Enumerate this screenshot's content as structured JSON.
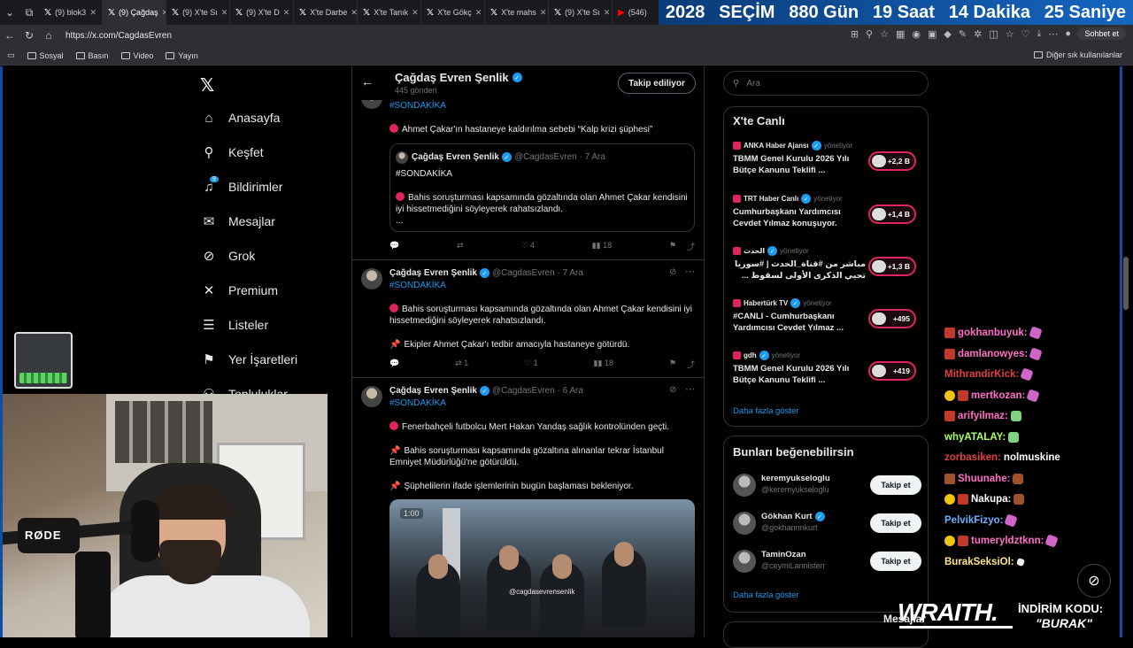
{
  "browser": {
    "tabs": [
      {
        "label": "(9) blok3",
        "icon": "x-icon",
        "active": false
      },
      {
        "label": "(9) Çağdaş",
        "icon": "x-icon",
        "active": true
      },
      {
        "label": "(9) X'te Sı",
        "icon": "x-icon",
        "active": false
      },
      {
        "label": "(9) X'te D",
        "icon": "x-icon",
        "active": false
      },
      {
        "label": "X'te Darbe",
        "icon": "x-icon",
        "active": false
      },
      {
        "label": "X'te Tanık",
        "icon": "x-icon",
        "active": false
      },
      {
        "label": "X'te Gökç",
        "icon": "x-icon",
        "active": false
      },
      {
        "label": "X'te mahs",
        "icon": "x-icon",
        "active": false
      },
      {
        "label": "(9) X'te Sı",
        "icon": "x-icon",
        "active": false
      },
      {
        "label": "(546)",
        "icon": "youtube-icon",
        "active": false
      }
    ],
    "banner": [
      "2028",
      "SEÇİM",
      "880 Gün",
      "19 Saat",
      "14 Dakika",
      "25 Saniye"
    ],
    "url": "https://x.com/CagdasEvren",
    "chat_button": "Sohbet et",
    "bookmarks": [
      "Sosyal",
      "Basın",
      "Video",
      "Yayın"
    ],
    "bookmarks_other": "Diğer sık kullanılanlar"
  },
  "nav": {
    "items": [
      {
        "label": "Anasayfa",
        "icon": "home-icon",
        "glyph": "⌂"
      },
      {
        "label": "Keşfet",
        "icon": "search-icon",
        "glyph": "⚲"
      },
      {
        "label": "Bildirimler",
        "icon": "bell-icon",
        "glyph": "♫"
      },
      {
        "label": "Mesajlar",
        "icon": "mail-icon",
        "glyph": "✉"
      },
      {
        "label": "Grok",
        "icon": "grok-icon",
        "glyph": "⊘"
      },
      {
        "label": "Premium",
        "icon": "x-premium-icon",
        "glyph": "✕"
      },
      {
        "label": "Listeler",
        "icon": "list-icon",
        "glyph": "☰"
      },
      {
        "label": "Yer İşaretleri",
        "icon": "bookmark-icon",
        "glyph": "⚑"
      },
      {
        "label": "Topluluklar",
        "icon": "communities-icon",
        "glyph": "⚇"
      }
    ],
    "notif_badge": "9"
  },
  "profile": {
    "name": "Çağdaş Evren Şenlik",
    "post_count": "445 gönderi",
    "follow_label": "Takip ediliyor"
  },
  "posts": [
    {
      "hashtag": "#SONDAKİKA",
      "lines": [
        "Ahmet Çakar'ın hastaneye kaldırılma sebebi “Kalp krizi şüphesi”"
      ],
      "quote": {
        "author": "Çağdaş Evren Şenlik",
        "handle": "@CagdasEvren · 7 Ara",
        "hashtag": "#SONDAKİKA",
        "text": "Bahis soruşturması kapsamında gözaltında olan Ahmet Çakar kendisini iyi hissetmediğini söyleyerek rahatsızlandı.",
        "ellipsis": "..."
      },
      "actions": {
        "reply": "",
        "repost": "",
        "like": "4",
        "views": "18"
      }
    },
    {
      "author": "Çağdaş Evren Şenlik",
      "handle": "@CagdasEvren · 7 Ara",
      "hashtag": "#SONDAKİKA",
      "line1": "Bahis soruşturması kapsamında gözaltında olan Ahmet Çakar kendisini iyi hissetmediğini söyleyerek rahatsızlandı.",
      "line2": "Ekipler Ahmet Çakar'ı tedbir amacıyla hastaneye götürdü.",
      "actions": {
        "reply": "",
        "repost": "1",
        "like": "1",
        "views": "18"
      }
    },
    {
      "author": "Çağdaş Evren Şenlik",
      "handle": "@CagdasEvren · 6 Ara",
      "hashtag": "#SONDAKİKA",
      "line1": "Fenerbahçeli futbolcu Mert Hakan Yandaş sağlık kontrolünden geçti.",
      "line2": "Bahis soruşturması kapsamında gözaltına alınanlar tekrar İstanbul Emniyet Müdürlüğü'ne götürüldü.",
      "line3": "Şüphelilerin ifade işlemlerinin bugün başlaması bekleniyor.",
      "video_time": "1:00",
      "video_watermark": "@cagdasevrensenlik"
    }
  ],
  "sidebar": {
    "search_placeholder": "Ara",
    "live": {
      "title": "X'te Canlı",
      "items": [
        {
          "source": "ANKA Haber Ajansı",
          "role": "yönetiyor",
          "title": "TBMM Genel Kurulu 2026 Yılı Bütçe Kanunu Teklifi ...",
          "count": "+2,2 B"
        },
        {
          "source": "TRT Haber Canlı",
          "role": "yönetiyor",
          "title": "Cumhurbaşkanı Yardımcısı Cevdet Yılmaz konuşuyor.",
          "count": "+1,4 B"
        },
        {
          "source": "الحدث",
          "role": "yönetiyor",
          "title": "مباشر من #قناة_الحدث | #سوريا تحيي الذكرى الأولى لسقوط ...",
          "count": "+1,3 B"
        },
        {
          "source": "Habertürk TV",
          "role": "yönetiyor",
          "title": "#CANLI - Cumhurbaşkanı Yardımcısı Cevdet Yılmaz ...",
          "count": "+495"
        },
        {
          "source": "gdh",
          "role": "yönetiyor",
          "title": "TBMM Genel Kurulu 2026 Yılı Bütçe Kanunu Teklifi ...",
          "count": "+419"
        }
      ],
      "more": "Daha fazla göster"
    },
    "suggest": {
      "title": "Bunları beğenebilirsin",
      "items": [
        {
          "name": "keremyukseloglu",
          "handle": "@keremyukseloglu",
          "verified": false,
          "button": "Takip et"
        },
        {
          "name": "Gökhan Kurt",
          "handle": "@gokhannnkurt",
          "verified": true,
          "button": "Takip et"
        },
        {
          "name": "TaminOzan",
          "handle": "@ceymiLannisterr",
          "verified": false,
          "button": "Takip et"
        }
      ],
      "more": "Daha fazla göster"
    },
    "messages_peek": "Mesajlar"
  },
  "chat": [
    {
      "user": "gokhanbuyuk:",
      "color": "#ff6ec7",
      "badge": "red",
      "msg": "",
      "emote": "pink"
    },
    {
      "user": "damlanowyes:",
      "color": "#ff6ec7",
      "badge": "red",
      "msg": "",
      "emote": "pink"
    },
    {
      "user": "MithrandirKick:",
      "color": "#e04040",
      "badge": "",
      "msg": "",
      "emote": "pink"
    },
    {
      "user": "mertkozan:",
      "color": "#ff6ec7",
      "badge": "gold",
      "msg": "",
      "emote": "pink"
    },
    {
      "user": "arifyilmaz:",
      "color": "#ff6ec7",
      "badge": "red",
      "msg": "",
      "emote": "green"
    },
    {
      "user": "whyATALAY:",
      "color": "#a8ff60",
      "badge": "",
      "msg": "",
      "emote": "green"
    },
    {
      "user": "zorbasiken:",
      "color": "#e04040",
      "badge": "",
      "msg": "nolmuskine",
      "emote": ""
    },
    {
      "user": "Shuunahe:",
      "color": "#ff6ec7",
      "badge": "brown",
      "msg": "",
      "emote": "brown"
    },
    {
      "user": "Nakupa:",
      "color": "#ffffff",
      "badge": "gold",
      "msg": "",
      "emote": "brown"
    },
    {
      "user": "PelvikFizyo:",
      "color": "#6ab0ff",
      "badge": "",
      "msg": "",
      "emote": "pink"
    },
    {
      "user": "tumeryldztknn:",
      "color": "#ff6ec7",
      "badge": "gold",
      "msg": "",
      "emote": "pink"
    },
    {
      "user": "BurakSeksiOl:",
      "color": "#ffe680",
      "badge": "",
      "msg": "",
      "emote": "white"
    }
  ],
  "promo": {
    "brand": "WRAITH.",
    "line1": "İNDİRİM KODU:",
    "code": "\"BURAK\""
  },
  "webcam": {
    "mic_label": "RØDE"
  }
}
